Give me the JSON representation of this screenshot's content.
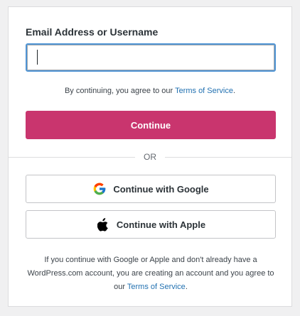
{
  "form": {
    "email_label": "Email Address or Username",
    "email_value": "",
    "email_placeholder": "",
    "tos_prefix": "By continuing, you agree to our ",
    "tos_link": "Terms of Service",
    "tos_suffix": ".",
    "continue_label": "Continue",
    "divider_label": "OR"
  },
  "social": {
    "google_label": "Continue with Google",
    "google_icon": "google-g-icon",
    "apple_label": "Continue with Apple",
    "apple_icon": "apple-logo-icon"
  },
  "footer": {
    "note_prefix": "If you continue with Google or Apple and don't already have a WordPress.com account, you are creating an account and you agree to our ",
    "note_link": "Terms of Service",
    "note_suffix": "."
  },
  "colors": {
    "primary": "#c9356e",
    "link": "#2271b1",
    "focus_border": "#4f94d4"
  }
}
